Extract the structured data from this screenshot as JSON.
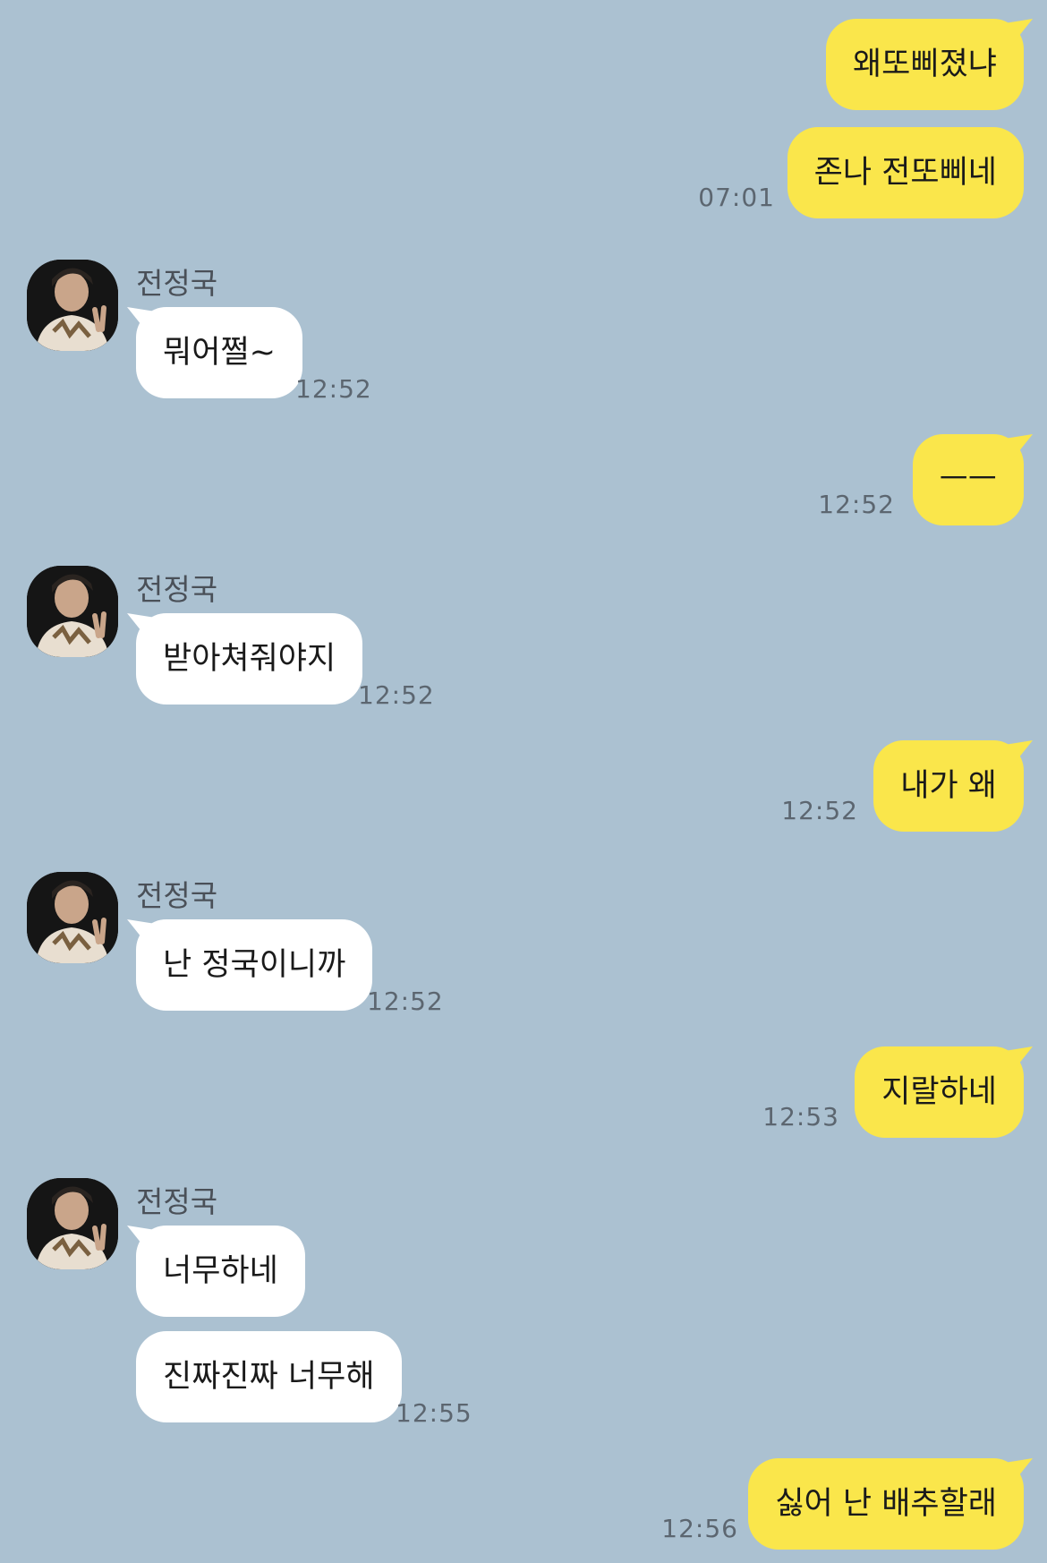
{
  "contact": {
    "name": "전정국"
  },
  "colors": {
    "background": "#abc1d1",
    "my_bubble": "#fae64b",
    "their_bubble": "#ffffff"
  },
  "messages": [
    {
      "text": "왜또삐졌냐",
      "sender": "me"
    },
    {
      "text": "존나 전또삐네",
      "sender": "me",
      "time": "07:01"
    },
    {
      "sender_name": "전정국",
      "text": "뭐어쩔~",
      "sender": "them",
      "time": "12:52"
    },
    {
      "text": "ㅡㅡ",
      "sender": "me",
      "time": "12:52"
    },
    {
      "sender_name": "전정국",
      "text": "받아쳐줘야지",
      "sender": "them",
      "time": "12:52"
    },
    {
      "text": "내가 왜",
      "sender": "me",
      "time": "12:52"
    },
    {
      "sender_name": "전정국",
      "text": "난 정국이니까",
      "sender": "them",
      "time": "12:52"
    },
    {
      "text": "지랄하네",
      "sender": "me",
      "time": "12:53"
    },
    {
      "sender_name": "전정국",
      "text": "너무하네",
      "sender": "them"
    },
    {
      "text": "진짜진짜 너무해",
      "sender": "them",
      "time": "12:55"
    },
    {
      "text": "싫어 난 배추할래",
      "sender": "me",
      "time": "12:56"
    }
  ]
}
